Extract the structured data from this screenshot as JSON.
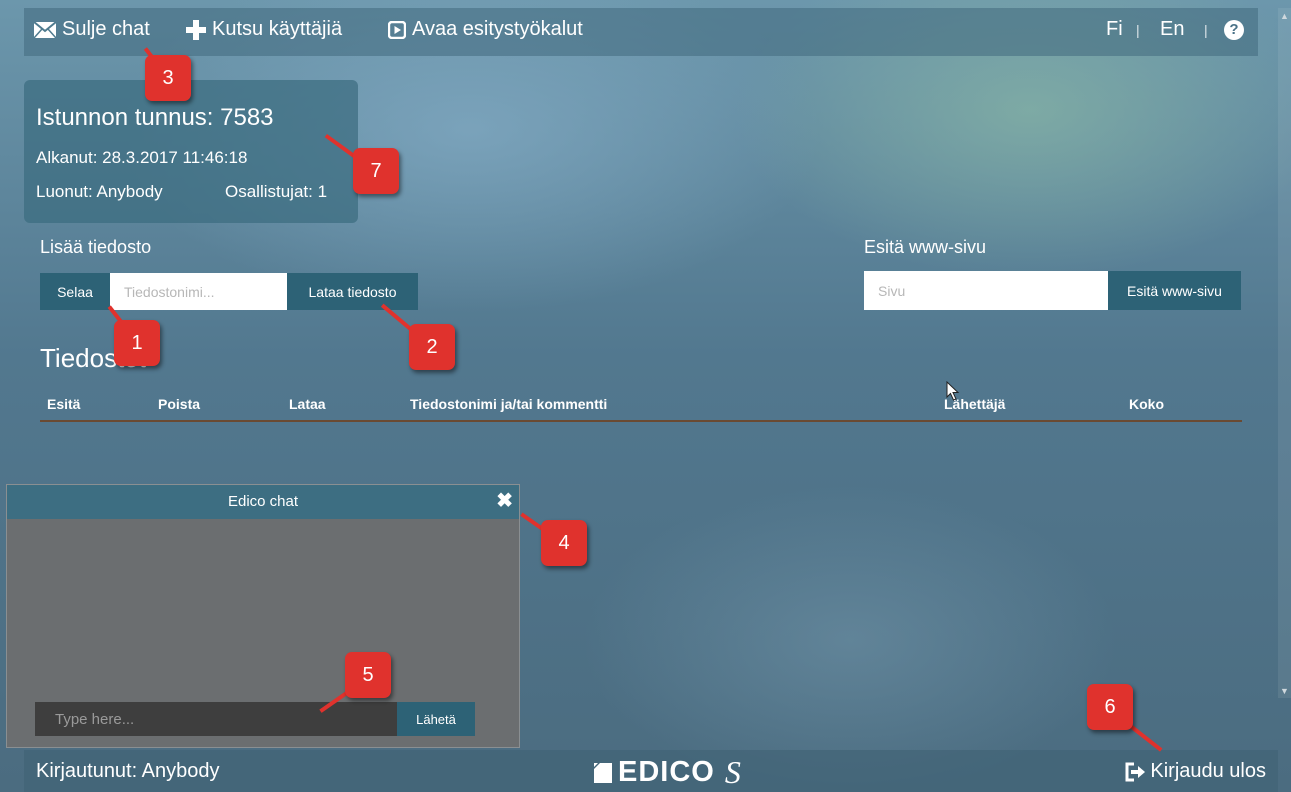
{
  "toolbar": {
    "close_chat_label": "Sulje chat",
    "invite_users_label": "Kutsu käyttäjiä",
    "open_presenter_tools_label": "Avaa esitystyökalut",
    "lang_fi": "Fi",
    "lang_en": "En",
    "separator": "|",
    "help": "?"
  },
  "session": {
    "title": "Istunnon tunnus: 7583",
    "started": "Alkanut: 28.3.2017 11:46:18",
    "creator": "Luonut: Anybody",
    "participants": "Osallistujat: 1"
  },
  "upload": {
    "label": "Lisää tiedosto",
    "browse_label": "Selaa",
    "filename_placeholder": "Tiedostonimi...",
    "upload_label": "Lataa tiedosto"
  },
  "web": {
    "label": "Esitä www-sivu",
    "page_placeholder": "Sivu",
    "present_label": "Esitä www-sivu"
  },
  "files": {
    "title": "Tiedostot",
    "columns": [
      "Esitä",
      "Poista",
      "Lataa",
      "Tiedostonimi ja/tai kommentti",
      "Lähettäjä",
      "Koko"
    ]
  },
  "chat": {
    "title": "Edico chat",
    "close": "✖",
    "input_placeholder": "Type here...",
    "send_label": "Lähetä"
  },
  "footer": {
    "logged_in": "Kirjautunut: Anybody",
    "logo_text": "EDICO",
    "logo_suffix": "S",
    "logout_label": "Kirjaudu ulos"
  },
  "annotations": [
    "1",
    "2",
    "3",
    "4",
    "5",
    "6",
    "7"
  ],
  "colors": {
    "accent": "#2d6276",
    "badge": "#e0322d",
    "chat_header": "#3d6e82"
  }
}
